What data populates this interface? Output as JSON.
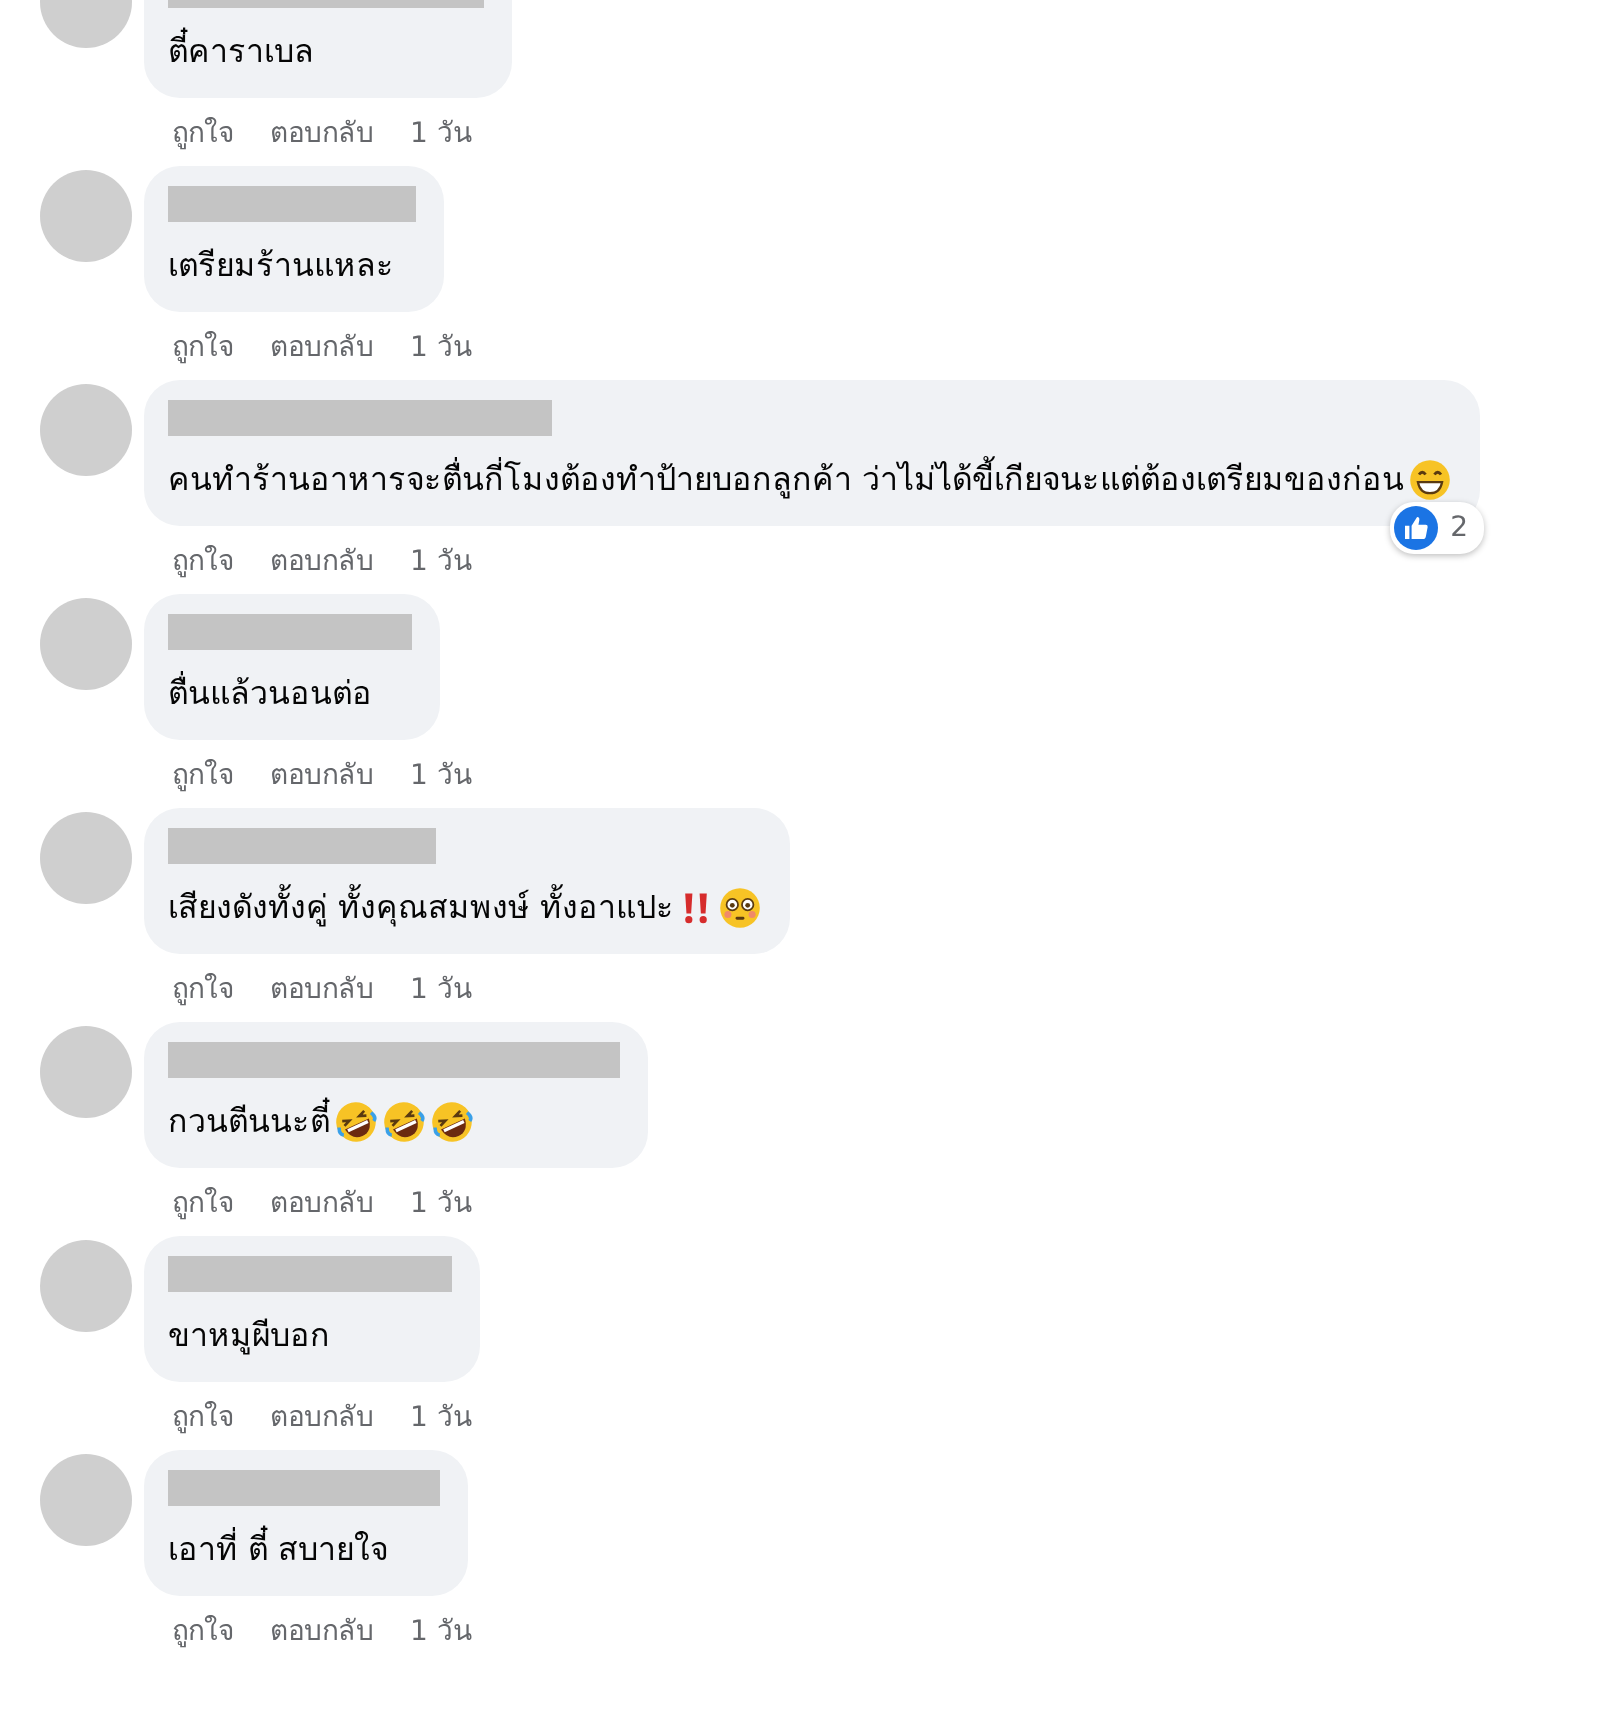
{
  "comments": [
    {
      "text": "ตี๋คาราเบล",
      "actions": {
        "like": "ถูกใจ",
        "reply": "ตอบกลับ",
        "time": "1 วัน"
      }
    },
    {
      "text": "เตรียมร้านแหละ",
      "actions": {
        "like": "ถูกใจ",
        "reply": "ตอบกลับ",
        "time": "1 วัน"
      }
    },
    {
      "text": "คนทำร้านอาหารจะตื่นกี่โมงต้องทำป้ายบอกลูกค้า ว่าไม่ได้ขี้เกียจนะแต่ต้องเตรียมของก่อน",
      "emojis": [
        {
          "kind": "grin"
        }
      ],
      "reaction": {
        "count": "2"
      },
      "actions": {
        "like": "ถูกใจ",
        "reply": "ตอบกลับ",
        "time": "1 วัน"
      }
    },
    {
      "text": "ตื่นแล้วนอนต่อ",
      "actions": {
        "like": "ถูกใจ",
        "reply": "ตอบกลับ",
        "time": "1 วัน"
      }
    },
    {
      "text": "เสียงดังทั้งคู่ ทั้งคุณสมพงษ์ ทั้งอาแปะ",
      "emojis": [
        {
          "kind": "exclamation"
        },
        {
          "kind": "flushed"
        }
      ],
      "actions": {
        "like": "ถูกใจ",
        "reply": "ตอบกลับ",
        "time": "1 วัน"
      }
    },
    {
      "text": "กวนตีนนะตี๋",
      "emojis": [
        {
          "kind": "laughing"
        },
        {
          "kind": "laughing"
        },
        {
          "kind": "laughing"
        }
      ],
      "actions": {
        "like": "ถูกใจ",
        "reply": "ตอบกลับ",
        "time": "1 วัน"
      }
    },
    {
      "text": "ขาหมูผีบอก",
      "actions": {
        "like": "ถูกใจ",
        "reply": "ตอบกลับ",
        "time": "1 วัน"
      }
    },
    {
      "text": "เอาที่ ตี๋ สบายใจ",
      "actions": {
        "like": "ถูกใจ",
        "reply": "ตอบกลับ",
        "time": "1 วัน"
      }
    }
  ]
}
